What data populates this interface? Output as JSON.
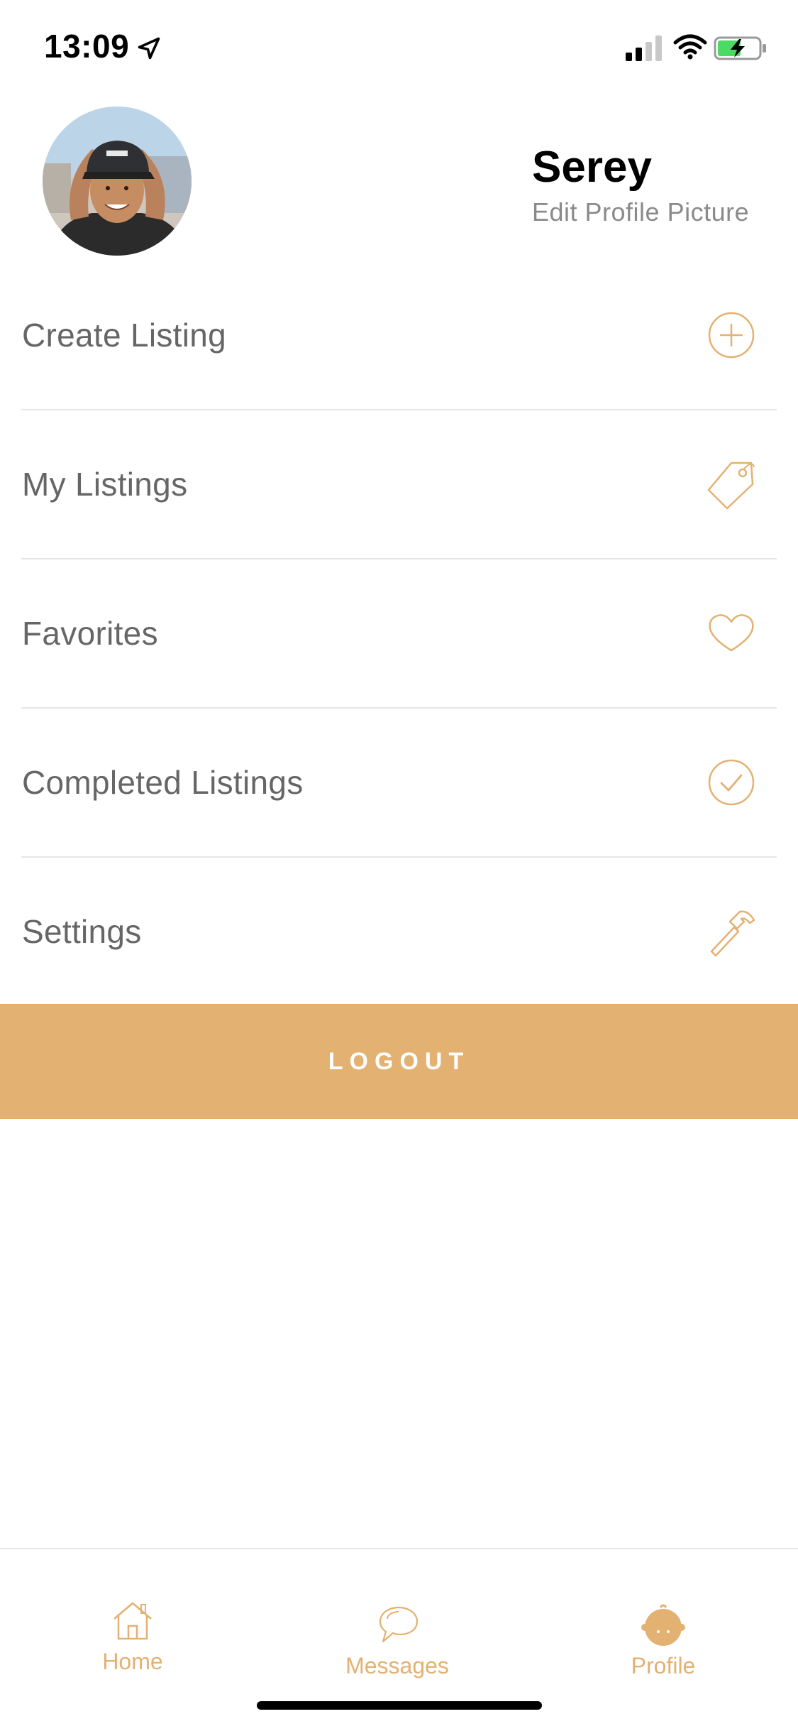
{
  "status_bar": {
    "time": "13:09"
  },
  "profile": {
    "name": "Serey",
    "edit_picture": "Edit Profile Picture"
  },
  "menu": [
    {
      "label": "Create Listing",
      "icon": "plus-circle-icon"
    },
    {
      "label": "My Listings",
      "icon": "tag-icon"
    },
    {
      "label": "Favorites",
      "icon": "heart-icon"
    },
    {
      "label": "Completed Listings",
      "icon": "check-circle-icon"
    },
    {
      "label": "Settings",
      "icon": "hammer-icon"
    }
  ],
  "logout": {
    "label": "LOGOUT"
  },
  "tabs": [
    {
      "label": "Home",
      "icon": "home-icon"
    },
    {
      "label": "Messages",
      "icon": "chat-bubble-icon"
    },
    {
      "label": "Profile",
      "icon": "baby-face-icon"
    }
  ],
  "colors": {
    "accent": "#e3b172",
    "text": "#666666",
    "divider": "#e6e6e6"
  }
}
